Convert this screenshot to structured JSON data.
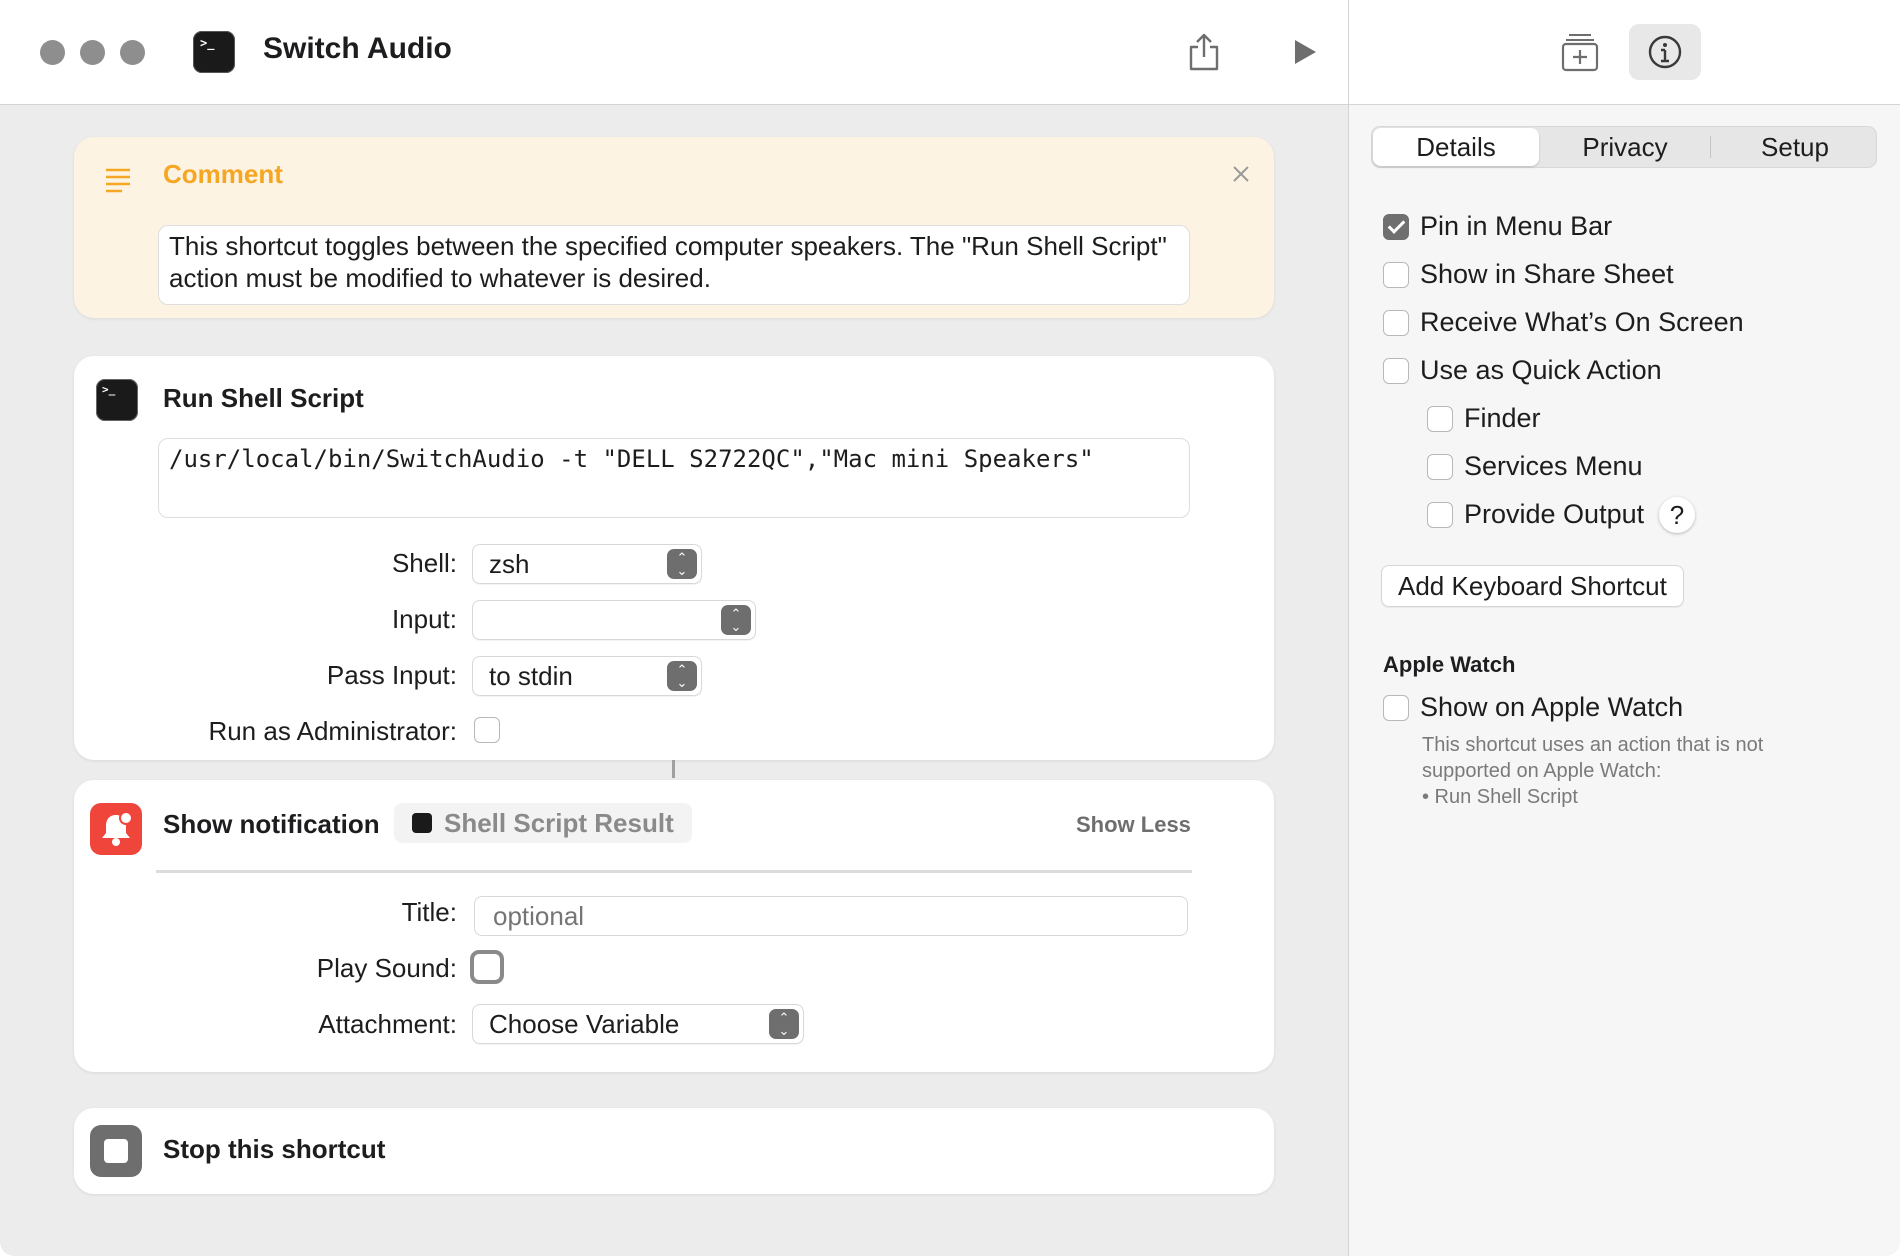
{
  "window": {
    "title": "Switch Audio"
  },
  "comment": {
    "title": "Comment",
    "text": "This shortcut toggles between the specified computer speakers. The \"Run Shell Script\" action must be modified to whatever is desired."
  },
  "run_shell": {
    "title": "Run Shell Script",
    "script": "/usr/local/bin/SwitchAudio -t \"DELL S2722QC\",\"Mac mini Speakers\"",
    "shell_label": "Shell:",
    "shell_value": "zsh",
    "input_label": "Input:",
    "input_value": "",
    "pass_input_label": "Pass Input:",
    "pass_input_value": "to stdin",
    "admin_label": "Run as Administrator:"
  },
  "notification": {
    "title": "Show notification",
    "token": "Shell Script Result",
    "show_less": "Show Less",
    "title_label": "Title:",
    "title_placeholder": "optional",
    "play_sound_label": "Play Sound:",
    "attachment_label": "Attachment:",
    "attachment_value": "Choose Variable"
  },
  "stop": {
    "title": "Stop this shortcut"
  },
  "sidebar": {
    "tabs": [
      "Details",
      "Privacy",
      "Setup"
    ],
    "selected_tab": "Details",
    "options": {
      "pin_menu_bar": "Pin in Menu Bar",
      "share_sheet": "Show in Share Sheet",
      "on_screen": "Receive What’s On Screen",
      "quick_action": "Use as Quick Action",
      "finder": "Finder",
      "services_menu": "Services Menu",
      "provide_output": "Provide Output"
    },
    "help": "?",
    "add_shortcut": "Add Keyboard Shortcut",
    "apple_watch": {
      "heading": "Apple Watch",
      "show": "Show on Apple Watch",
      "note1": "This shortcut uses an action that is not",
      "note2": "supported on Apple Watch:",
      "note3": "• Run Shell Script"
    }
  },
  "icons": {
    "terminal": "terminal-icon",
    "share": "share-icon",
    "run": "play-icon",
    "library": "action-library-icon",
    "info": "info-icon",
    "comment": "comment-lines-icon",
    "close": "close-icon",
    "notification": "bell-icon",
    "stop": "stop-icon"
  },
  "colors": {
    "comment_accent": "#f5a623",
    "comment_bg": "#fdf3e3",
    "notification_red": "#f0453a",
    "stop_gray": "#6e6e6e"
  }
}
